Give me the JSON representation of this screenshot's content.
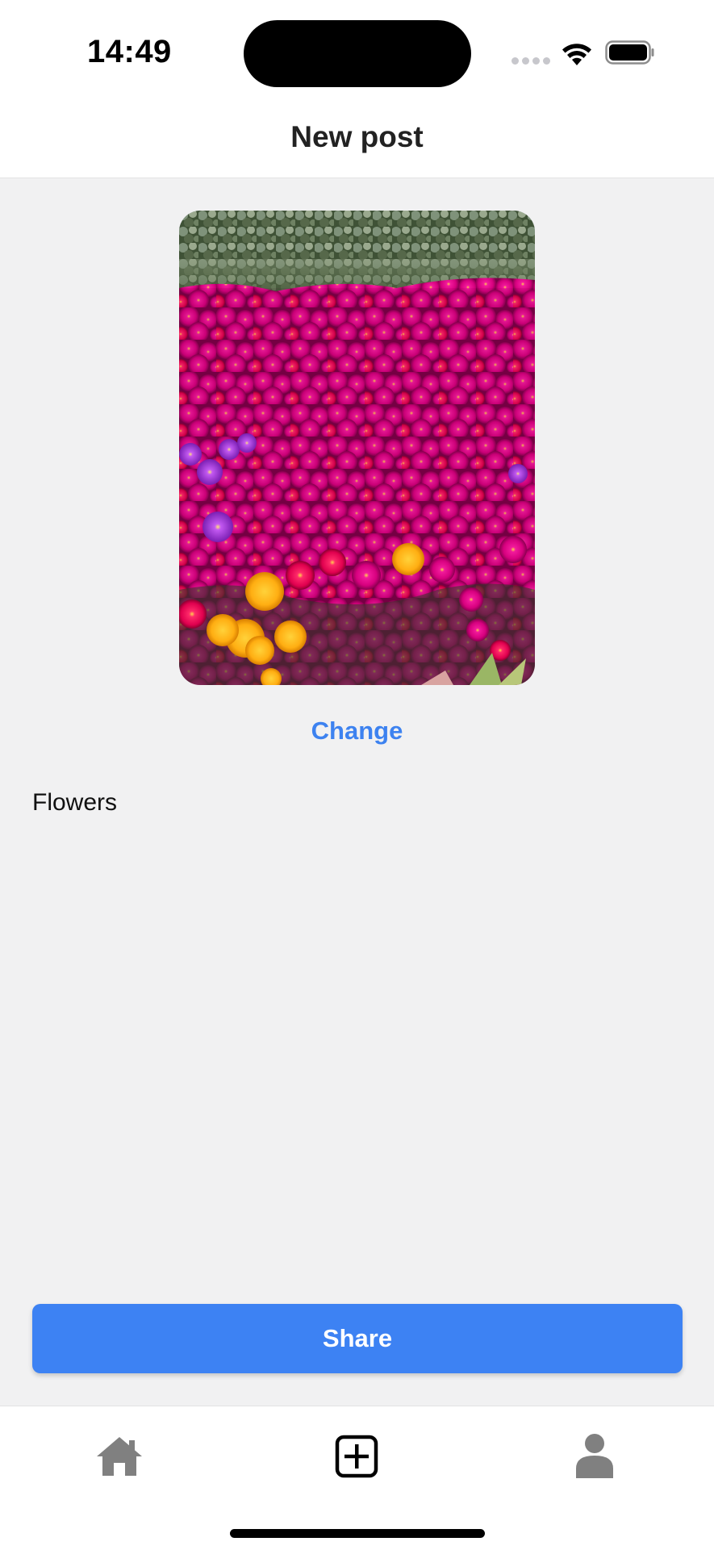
{
  "status_bar": {
    "time": "14:49"
  },
  "header": {
    "title": "New post"
  },
  "post": {
    "change_label": "Change",
    "caption": "Flowers"
  },
  "actions": {
    "share_label": "Share"
  },
  "tab_bar": {
    "tabs": [
      {
        "icon": "home-icon",
        "active": false
      },
      {
        "icon": "add-post-icon",
        "active": true
      },
      {
        "icon": "profile-icon",
        "active": false
      }
    ]
  },
  "colors": {
    "accent": "#3d82f3",
    "link": "#3d82f0",
    "background": "#f1f1f2",
    "inactive_icon": "#808080",
    "active_icon": "#000000"
  }
}
